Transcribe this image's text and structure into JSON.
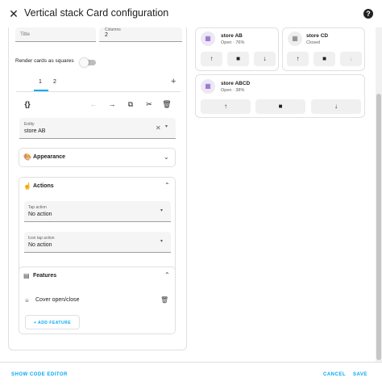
{
  "dialog": {
    "title": "Vertical stack Card configuration",
    "close_icon": "close-icon",
    "help_icon": "help-icon"
  },
  "form": {
    "title_label": "Title",
    "columns_label": "Columns",
    "columns_value": "2",
    "render_squares_label": "Render cards as squares",
    "render_squares_on": false
  },
  "tabs": [
    {
      "label": "1",
      "selected": true
    },
    {
      "label": "2",
      "selected": false
    }
  ],
  "toolbar": {
    "code_icon": "{}",
    "back_icon": "←",
    "forward_icon": "→",
    "copy_icon": "⧉",
    "cut_icon": "✂",
    "delete_icon": "🗑"
  },
  "entity": {
    "label": "Entity",
    "value": "store AB"
  },
  "appearance": {
    "title": "Appearance"
  },
  "actions": {
    "title": "Actions",
    "tap_label": "Tap action",
    "tap_value": "No action",
    "icon_tap_label": "Icon tap action",
    "icon_tap_value": "No action"
  },
  "features": {
    "title": "Features",
    "item": "Cover open/close",
    "add_button": "ADD FEATURE"
  },
  "preview": {
    "cards": [
      {
        "name": "store AB",
        "state": "Open · 76%",
        "icon": "window-shutter-open-icon"
      },
      {
        "name": "store CD",
        "state": "Closed",
        "icon": "window-shutter-icon"
      },
      {
        "name": "store ABCD",
        "state": "Open · 38%",
        "icon": "window-shutter-open-icon"
      }
    ],
    "up": "↑",
    "stop": "■",
    "down": "↓"
  },
  "footer": {
    "show_code": "SHOW CODE EDITOR",
    "cancel": "CANCEL",
    "save": "SAVE"
  }
}
